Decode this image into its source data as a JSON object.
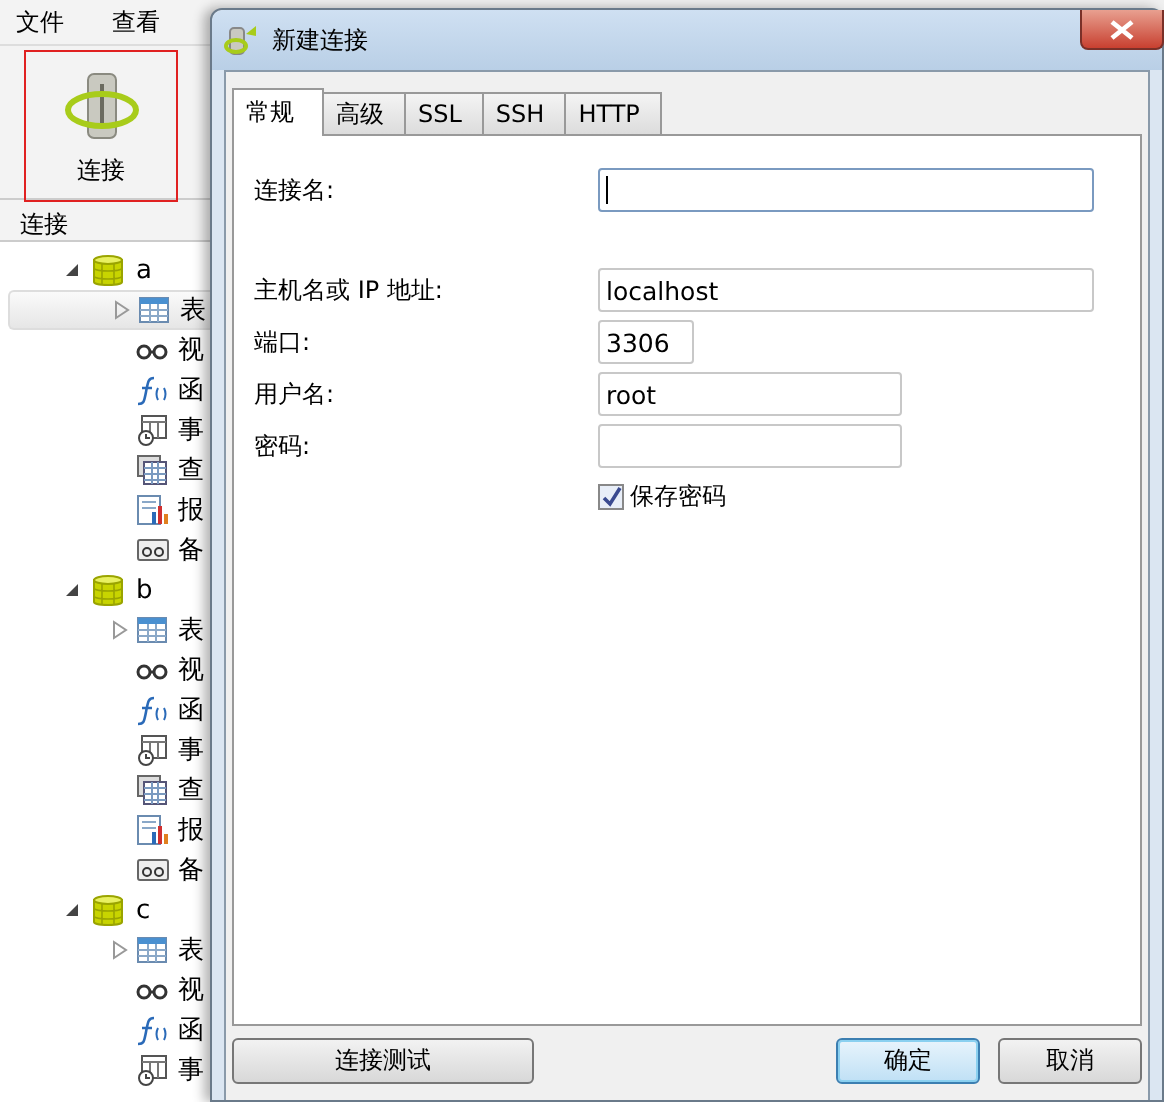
{
  "menu": [
    {
      "label": "文件"
    },
    {
      "label": "查看"
    }
  ],
  "toolbar": {
    "buttons": [
      {
        "label": "连接",
        "selected": true
      }
    ]
  },
  "sidebar": {
    "title": "连接",
    "tree": [
      {
        "label": "a",
        "expanded": true,
        "children": [
          {
            "kind": "table",
            "label": "表",
            "selected": true
          },
          {
            "kind": "view",
            "label": "视",
            "selected": false
          },
          {
            "kind": "function",
            "label": "函",
            "selected": false
          },
          {
            "kind": "event",
            "label": "事",
            "selected": false
          },
          {
            "kind": "query",
            "label": "查",
            "selected": false
          },
          {
            "kind": "report",
            "label": "报",
            "selected": false
          },
          {
            "kind": "backup",
            "label": "备",
            "selected": false
          }
        ]
      },
      {
        "label": "b",
        "expanded": true,
        "children": [
          {
            "kind": "table",
            "label": "表",
            "selected": false
          },
          {
            "kind": "view",
            "label": "视",
            "selected": false
          },
          {
            "kind": "function",
            "label": "函",
            "selected": false
          },
          {
            "kind": "event",
            "label": "事",
            "selected": false
          },
          {
            "kind": "query",
            "label": "查",
            "selected": false
          },
          {
            "kind": "report",
            "label": "报",
            "selected": false
          },
          {
            "kind": "backup",
            "label": "备",
            "selected": false
          }
        ]
      },
      {
        "label": "c",
        "expanded": true,
        "children": [
          {
            "kind": "table",
            "label": "表",
            "selected": false
          },
          {
            "kind": "view",
            "label": "视",
            "selected": false
          },
          {
            "kind": "function",
            "label": "函",
            "selected": false
          },
          {
            "kind": "event",
            "label": "事",
            "selected": false
          }
        ]
      }
    ]
  },
  "dialog": {
    "title": "新建连接",
    "tabs": [
      {
        "label": "常规",
        "selected": true
      },
      {
        "label": "高级",
        "selected": false
      },
      {
        "label": "SSL",
        "selected": false
      },
      {
        "label": "SSH",
        "selected": false
      },
      {
        "label": "HTTP",
        "selected": false
      }
    ],
    "fields": [
      {
        "label": "连接名:",
        "focused": true
      },
      {
        "label": "主机名或 IP 地址:",
        "value": "localhost",
        "focused": false
      },
      {
        "label": "端口:",
        "value": "3306",
        "focused": false
      },
      {
        "label": "用户名:",
        "value": "root",
        "focused": false
      },
      {
        "label": "密码:",
        "focused": false
      }
    ],
    "checkbox": {
      "label": "保存密码",
      "checked": true
    },
    "buttons": [
      {
        "label": "连接测试",
        "default": false
      },
      {
        "label": "确定",
        "default": true
      },
      {
        "label": "取消",
        "default": false
      }
    ]
  }
}
